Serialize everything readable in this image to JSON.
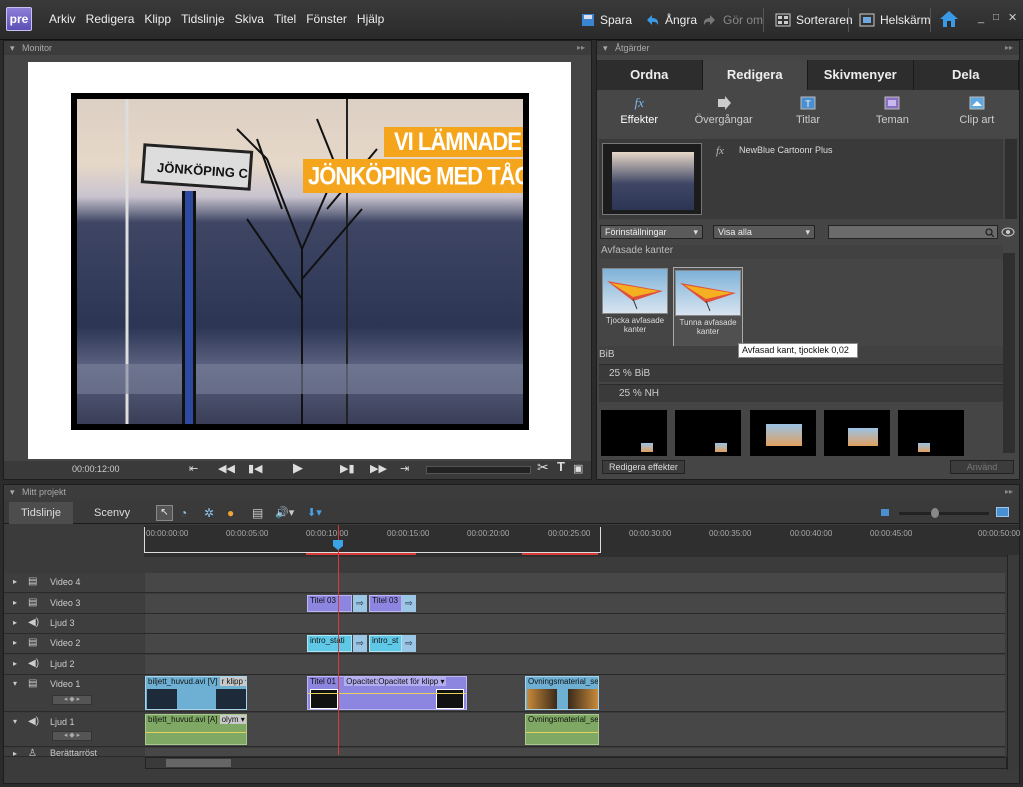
{
  "app": {
    "logo": "pre"
  },
  "menu": [
    "Arkiv",
    "Redigera",
    "Klipp",
    "Tidslinje",
    "Skiva",
    "Titel",
    "Fönster",
    "Hjälp"
  ],
  "toolbar": {
    "save": "Spara",
    "undo": "Ångra",
    "redo": "Gör om",
    "organizer": "Sorteraren",
    "fullscreen": "Helskärm"
  },
  "monitor": {
    "header": "Monitor",
    "timecode": "00:00:12:00",
    "title_line1": "VI LÄMNADE",
    "title_line2": "JÖNKÖPING MED TÅG",
    "sign_text": "JÖNKÖPING C"
  },
  "actions": {
    "header": "Åtgärder",
    "tabs": [
      "Ordna",
      "Redigera",
      "Skivmenyer",
      "Dela"
    ],
    "active_tab": "Redigera",
    "subtabs": [
      "Effekter",
      "Övergångar",
      "Titlar",
      "Teman",
      "Clip art"
    ],
    "effect_name": "NewBlue Cartoonr Plus",
    "presets_dropdown": "Förinställningar",
    "show_dropdown": "Visa alla",
    "group_bevel": "Avfasade kanter",
    "preset1": "Tjocka avfasade kanter",
    "preset2": "Tunna avfasade kanter",
    "tooltip": "Avfasad kant, tjocklek 0,02",
    "group_pip": "BiB",
    "pip_25": "25 % BiB",
    "nh_25": "25 % NH",
    "edit_effects": "Redigera effekter",
    "apply": "Använd"
  },
  "project": {
    "header": "Mitt projekt",
    "tab_timeline": "Tidslinje",
    "tab_scene": "Scenvy",
    "ruler": [
      "00:00:00:00",
      "00:00:05:00",
      "00:00:10:00",
      "00:00:15:00",
      "00:00:20:00",
      "00:00:25:00",
      "00:00:30:00",
      "00:00:35:00",
      "00:00:40:00",
      "00:00:45:00",
      "00:00:50:00"
    ],
    "tracks": [
      "Video 4",
      "Video 3",
      "Ljud 3",
      "Video 2",
      "Ljud 2",
      "Video 1",
      "Ljud 1",
      "Berättarröst"
    ],
    "clips": {
      "titel03a": "Titel 03",
      "titel03b": "Titel 03",
      "intro1": "intro_stati",
      "intro2": "intro_st",
      "v1a": "biljett_huvud.avi [V]",
      "v1a_fx": "r klipp ▾",
      "titel01": "Titel 01",
      "opacity": "Opacitet:Opacitet för klipp ▾",
      "ovn_v": "Ovningsmaterial_se",
      "a1a": "biljett_huvud.avi [A]",
      "a1a_fx": "olym ▾",
      "ovn_a": "Ovningsmaterial_se"
    }
  },
  "colors": {
    "accent": "#5c4fb6",
    "title_orange": "#f4a51b",
    "cti": "#d83a3a"
  }
}
